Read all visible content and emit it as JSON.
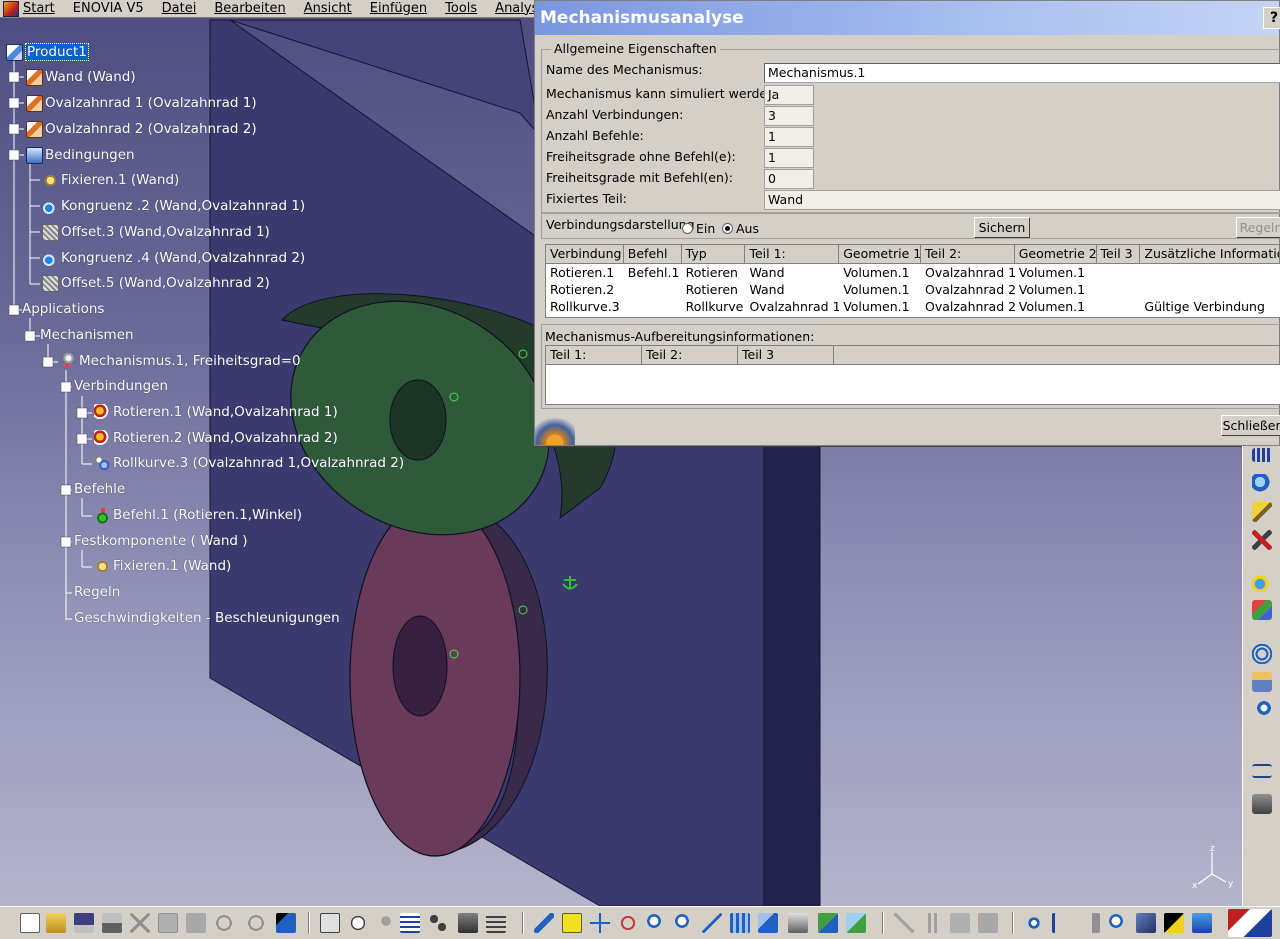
{
  "menubar": {
    "items": [
      {
        "label": "Start"
      },
      {
        "label": "ENOVIA V5"
      },
      {
        "label": "Datei"
      },
      {
        "label": "Bearbeiten"
      },
      {
        "label": "Ansicht"
      },
      {
        "label": "Einfügen"
      },
      {
        "label": "Tools"
      },
      {
        "label": "Analyse"
      }
    ]
  },
  "tree": {
    "nodes": [
      {
        "label": "Product1",
        "icon": "product-icon"
      },
      {
        "label": "Wand (Wand)",
        "icon": "part-icon"
      },
      {
        "label": "Ovalzahnrad 1 (Ovalzahnrad 1)",
        "icon": "part-icon"
      },
      {
        "label": "Ovalzahnrad 2 (Ovalzahnrad 2)",
        "icon": "part-icon"
      },
      {
        "label": "Bedingungen",
        "icon": "constraints-icon"
      },
      {
        "label": "Fixieren.1 (Wand)",
        "icon": "fix-icon"
      },
      {
        "label": "Kongruenz .2 (Wand,Ovalzahnrad 1)",
        "icon": "coincidence-icon"
      },
      {
        "label": "Offset.3 (Wand,Ovalzahnrad 1)",
        "icon": "offset-icon"
      },
      {
        "label": "Kongruenz .4 (Wand,Ovalzahnrad 2)",
        "icon": "coincidence-icon"
      },
      {
        "label": "Offset.5 (Wand,Ovalzahnrad 2)",
        "icon": "offset-icon"
      },
      {
        "label": "Applications"
      },
      {
        "label": "Mechanismen"
      },
      {
        "label": "Mechanismus.1, Freiheitsgrad=0",
        "icon": "mechanism-icon"
      },
      {
        "label": "Verbindungen"
      },
      {
        "label": "Rotieren.1 (Wand,Ovalzahnrad 1)",
        "icon": "revolute-joint-icon"
      },
      {
        "label": "Rotieren.2 (Wand,Ovalzahnrad 2)",
        "icon": "revolute-joint-icon"
      },
      {
        "label": "Rollkurve.3 (Ovalzahnrad 1,Ovalzahnrad 2)",
        "icon": "roll-curve-icon"
      },
      {
        "label": "Befehle"
      },
      {
        "label": "Befehl.1 (Rotieren.1,Winkel)",
        "icon": "command-icon"
      },
      {
        "label": "Festkomponente ( Wand )"
      },
      {
        "label": "Fixieren.1 (Wand)",
        "icon": "fix-icon"
      },
      {
        "label": "Regeln"
      },
      {
        "label": "Geschwindigkeiten - Beschleunigungen"
      }
    ]
  },
  "dialog": {
    "title": "Mechanismusanalyse",
    "help": "?",
    "general": {
      "legend": "Allgemeine Eigenschaften",
      "name_label": "Name des Mechanismus:",
      "name_value": "Mechanismus.1",
      "simulatable_label": "Mechanismus kann simuliert werden:",
      "simulatable_value": "Ja",
      "joints_label": "Anzahl Verbindungen:",
      "joints_value": "3",
      "commands_label": "Anzahl Befehle:",
      "commands_value": "1",
      "dof_without_label": "Freiheitsgrade ohne Befehl(e):",
      "dof_without_value": "1",
      "dof_with_label": "Freiheitsgrade mit Befehl(en):",
      "dof_with_value": "0",
      "fixed_label": "Fixiertes Teil:",
      "fixed_value": "Wand"
    },
    "joint_display": {
      "label": "Verbindungsdarstellung",
      "on_label": "Ein",
      "off_label": "Aus",
      "selected": "Aus",
      "save_button": "Sichern",
      "rules_button": "Regeln"
    },
    "joints_table": {
      "headers": [
        "Verbindung",
        "Befehl",
        "Typ",
        "Teil 1:",
        "Geometrie 1",
        "Teil 2:",
        "Geometrie 2",
        "Teil 3",
        "Zusätzliche Information"
      ],
      "rows": [
        [
          "Rotieren.1",
          "Befehl.1",
          "Rotieren",
          "Wand",
          "Volumen.1",
          "Ovalzahnrad 1",
          "Volumen.1",
          "",
          ""
        ],
        [
          "Rotieren.2",
          "",
          "Rotieren",
          "Wand",
          "Volumen.1",
          "Ovalzahnrad 2",
          "Volumen.1",
          "",
          ""
        ],
        [
          "Rollkurve.3",
          "",
          "Rollkurve",
          "Ovalzahnrad 1",
          "Volumen.1",
          "Ovalzahnrad 2",
          "Volumen.1",
          "",
          "Gültige Verbindung"
        ]
      ]
    },
    "update_info": {
      "legend": "Mechanismus-Aufbereitungsinformationen:",
      "headers": [
        "Teil 1:",
        "Teil 2:",
        "Teil 3"
      ]
    },
    "close_button": "Schließen"
  },
  "compass": {
    "z": "z",
    "x": "x",
    "y": "y"
  },
  "colors": {
    "selection": "#0a64d0",
    "gear_top": "#2e5a3a",
    "gear_bottom": "#6a3a5a",
    "wall": "#3a3a6e"
  }
}
